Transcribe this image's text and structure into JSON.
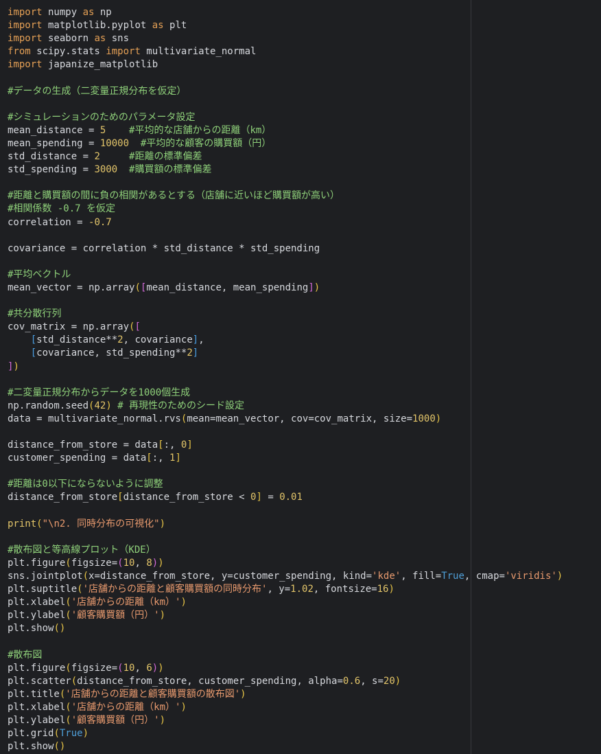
{
  "lines": [
    [
      {
        "t": "import",
        "c": "kw"
      },
      {
        "t": " numpy ",
        "c": "pl"
      },
      {
        "t": "as",
        "c": "kw"
      },
      {
        "t": " np",
        "c": "pl"
      }
    ],
    [
      {
        "t": "import",
        "c": "kw"
      },
      {
        "t": " matplotlib.pyplot ",
        "c": "pl"
      },
      {
        "t": "as",
        "c": "kw"
      },
      {
        "t": " plt",
        "c": "pl"
      }
    ],
    [
      {
        "t": "import",
        "c": "kw"
      },
      {
        "t": " seaborn ",
        "c": "pl"
      },
      {
        "t": "as",
        "c": "kw"
      },
      {
        "t": " sns",
        "c": "pl"
      }
    ],
    [
      {
        "t": "from",
        "c": "kw"
      },
      {
        "t": " scipy.stats ",
        "c": "pl"
      },
      {
        "t": "import",
        "c": "kw"
      },
      {
        "t": " multivariate_normal",
        "c": "pl"
      }
    ],
    [
      {
        "t": "import",
        "c": "kw"
      },
      {
        "t": " japanize_matplotlib",
        "c": "pl"
      }
    ],
    [],
    [
      {
        "t": "#データの生成（二変量正規分布を仮定）",
        "c": "cm"
      }
    ],
    [],
    [
      {
        "t": "#シミュレーションのためのパラメータ設定",
        "c": "cm"
      }
    ],
    [
      {
        "t": "mean_distance = ",
        "c": "pl"
      },
      {
        "t": "5",
        "c": "nm"
      },
      {
        "t": "    ",
        "c": "pl"
      },
      {
        "t": "#平均的な店舗からの距離（km）",
        "c": "cm"
      }
    ],
    [
      {
        "t": "mean_spending = ",
        "c": "pl"
      },
      {
        "t": "10000",
        "c": "nm"
      },
      {
        "t": "  ",
        "c": "pl"
      },
      {
        "t": "#平均的な顧客の購買額（円）",
        "c": "cm"
      }
    ],
    [
      {
        "t": "std_distance = ",
        "c": "pl"
      },
      {
        "t": "2",
        "c": "nm"
      },
      {
        "t": "     ",
        "c": "pl"
      },
      {
        "t": "#距離の標準偏差",
        "c": "cm"
      }
    ],
    [
      {
        "t": "std_spending = ",
        "c": "pl"
      },
      {
        "t": "3000",
        "c": "nm"
      },
      {
        "t": "  ",
        "c": "pl"
      },
      {
        "t": "#購買額の標準偏差",
        "c": "cm"
      }
    ],
    [],
    [
      {
        "t": "#距離と購買額の間に負の相関があるとする（店舗に近いほど購買額が高い）",
        "c": "cm"
      }
    ],
    [
      {
        "t": "#相関係数 -0.7 を仮定",
        "c": "cm"
      }
    ],
    [
      {
        "t": "correlation = ",
        "c": "pl"
      },
      {
        "t": "-0.7",
        "c": "nm"
      }
    ],
    [],
    [
      {
        "t": "covariance = correlation * std_distance * std_spending",
        "c": "pl"
      }
    ],
    [],
    [
      {
        "t": "#平均ベクトル",
        "c": "cm"
      }
    ],
    [
      {
        "t": "mean_vector = np.array",
        "c": "pl"
      },
      {
        "t": "(",
        "c": "br1"
      },
      {
        "t": "[",
        "c": "br2"
      },
      {
        "t": "mean_distance, mean_spending",
        "c": "pl"
      },
      {
        "t": "]",
        "c": "br2"
      },
      {
        "t": ")",
        "c": "br1"
      }
    ],
    [],
    [
      {
        "t": "#共分散行列",
        "c": "cm"
      }
    ],
    [
      {
        "t": "cov_matrix = np.array",
        "c": "pl"
      },
      {
        "t": "(",
        "c": "br1"
      },
      {
        "t": "[",
        "c": "br2"
      }
    ],
    [
      {
        "t": "    ",
        "c": "pl"
      },
      {
        "t": "[",
        "c": "br3"
      },
      {
        "t": "std_distance**",
        "c": "pl"
      },
      {
        "t": "2",
        "c": "nm"
      },
      {
        "t": ", covariance",
        "c": "pl"
      },
      {
        "t": "]",
        "c": "br3"
      },
      {
        "t": ",",
        "c": "pl"
      }
    ],
    [
      {
        "t": "    ",
        "c": "pl"
      },
      {
        "t": "[",
        "c": "br3"
      },
      {
        "t": "covariance, std_spending**",
        "c": "pl"
      },
      {
        "t": "2",
        "c": "nm"
      },
      {
        "t": "]",
        "c": "br3"
      }
    ],
    [
      {
        "t": "]",
        "c": "br2"
      },
      {
        "t": ")",
        "c": "br1"
      }
    ],
    [],
    [
      {
        "t": "#二変量正規分布からデータを1000個生成",
        "c": "cm"
      }
    ],
    [
      {
        "t": "np.random.seed",
        "c": "pl"
      },
      {
        "t": "(",
        "c": "br1"
      },
      {
        "t": "42",
        "c": "nm"
      },
      {
        "t": ")",
        "c": "br1"
      },
      {
        "t": " ",
        "c": "pl"
      },
      {
        "t": "# 再現性のためのシード設定",
        "c": "cm"
      }
    ],
    [
      {
        "t": "data = multivariate_normal.rvs",
        "c": "pl"
      },
      {
        "t": "(",
        "c": "br1"
      },
      {
        "t": "mean=mean_vector, cov=cov_matrix, size=",
        "c": "pl"
      },
      {
        "t": "1000",
        "c": "nm"
      },
      {
        "t": ")",
        "c": "br1"
      }
    ],
    [],
    [
      {
        "t": "distance_from_store = data",
        "c": "pl"
      },
      {
        "t": "[",
        "c": "br1"
      },
      {
        "t": ":, ",
        "c": "pl"
      },
      {
        "t": "0",
        "c": "nm"
      },
      {
        "t": "]",
        "c": "br1"
      }
    ],
    [
      {
        "t": "customer_spending = data",
        "c": "pl"
      },
      {
        "t": "[",
        "c": "br1"
      },
      {
        "t": ":, ",
        "c": "pl"
      },
      {
        "t": "1",
        "c": "nm"
      },
      {
        "t": "]",
        "c": "br1"
      }
    ],
    [],
    [
      {
        "t": "#距離は0以下にならないように調整",
        "c": "cm"
      }
    ],
    [
      {
        "t": "distance_from_store",
        "c": "pl"
      },
      {
        "t": "[",
        "c": "br1"
      },
      {
        "t": "distance_from_store < ",
        "c": "pl"
      },
      {
        "t": "0",
        "c": "nm"
      },
      {
        "t": "]",
        "c": "br1"
      },
      {
        "t": " = ",
        "c": "pl"
      },
      {
        "t": "0.01",
        "c": "nm"
      }
    ],
    [],
    [
      {
        "t": "print",
        "c": "nm"
      },
      {
        "t": "(",
        "c": "br1"
      },
      {
        "t": "\"\\n2. 同時分布の可視化\"",
        "c": "st"
      },
      {
        "t": ")",
        "c": "br1"
      }
    ],
    [],
    [
      {
        "t": "#散布図と等高線プロット（KDE）",
        "c": "cm"
      }
    ],
    [
      {
        "t": "plt.figure",
        "c": "pl"
      },
      {
        "t": "(",
        "c": "br1"
      },
      {
        "t": "figsize=",
        "c": "pl"
      },
      {
        "t": "(",
        "c": "br2"
      },
      {
        "t": "10",
        "c": "nm"
      },
      {
        "t": ", ",
        "c": "pl"
      },
      {
        "t": "8",
        "c": "nm"
      },
      {
        "t": ")",
        "c": "br2"
      },
      {
        "t": ")",
        "c": "br1"
      }
    ],
    [
      {
        "t": "sns.jointplot",
        "c": "pl"
      },
      {
        "t": "(",
        "c": "br1"
      },
      {
        "t": "x=distance_from_store, y=customer_spending, kind=",
        "c": "pl"
      },
      {
        "t": "'kde'",
        "c": "st"
      },
      {
        "t": ", fill=",
        "c": "pl"
      },
      {
        "t": "True",
        "c": "bl"
      },
      {
        "t": ", cmap=",
        "c": "pl"
      },
      {
        "t": "'viridis'",
        "c": "st"
      },
      {
        "t": ")",
        "c": "br1"
      }
    ],
    [
      {
        "t": "plt.suptitle",
        "c": "pl"
      },
      {
        "t": "(",
        "c": "br1"
      },
      {
        "t": "'店舗からの距離と顧客購買額の同時分布'",
        "c": "st"
      },
      {
        "t": ", y=",
        "c": "pl"
      },
      {
        "t": "1.02",
        "c": "nm"
      },
      {
        "t": ", fontsize=",
        "c": "pl"
      },
      {
        "t": "16",
        "c": "nm"
      },
      {
        "t": ")",
        "c": "br1"
      }
    ],
    [
      {
        "t": "plt.xlabel",
        "c": "pl"
      },
      {
        "t": "(",
        "c": "br1"
      },
      {
        "t": "'店舗からの距離（km）'",
        "c": "st"
      },
      {
        "t": ")",
        "c": "br1"
      }
    ],
    [
      {
        "t": "plt.ylabel",
        "c": "pl"
      },
      {
        "t": "(",
        "c": "br1"
      },
      {
        "t": "'顧客購買額（円）'",
        "c": "st"
      },
      {
        "t": ")",
        "c": "br1"
      }
    ],
    [
      {
        "t": "plt.show",
        "c": "pl"
      },
      {
        "t": "()",
        "c": "br1"
      }
    ],
    [],
    [
      {
        "t": "#散布図",
        "c": "cm"
      }
    ],
    [
      {
        "t": "plt.figure",
        "c": "pl"
      },
      {
        "t": "(",
        "c": "br1"
      },
      {
        "t": "figsize=",
        "c": "pl"
      },
      {
        "t": "(",
        "c": "br2"
      },
      {
        "t": "10",
        "c": "nm"
      },
      {
        "t": ", ",
        "c": "pl"
      },
      {
        "t": "6",
        "c": "nm"
      },
      {
        "t": ")",
        "c": "br2"
      },
      {
        "t": ")",
        "c": "br1"
      }
    ],
    [
      {
        "t": "plt.scatter",
        "c": "pl"
      },
      {
        "t": "(",
        "c": "br1"
      },
      {
        "t": "distance_from_store, customer_spending, alpha=",
        "c": "pl"
      },
      {
        "t": "0.6",
        "c": "nm"
      },
      {
        "t": ", s=",
        "c": "pl"
      },
      {
        "t": "20",
        "c": "nm"
      },
      {
        "t": ")",
        "c": "br1"
      }
    ],
    [
      {
        "t": "plt.title",
        "c": "pl"
      },
      {
        "t": "(",
        "c": "br1"
      },
      {
        "t": "'店舗からの距離と顧客購買額の散布図'",
        "c": "st"
      },
      {
        "t": ")",
        "c": "br1"
      }
    ],
    [
      {
        "t": "plt.xlabel",
        "c": "pl"
      },
      {
        "t": "(",
        "c": "br1"
      },
      {
        "t": "'店舗からの距離（km）'",
        "c": "st"
      },
      {
        "t": ")",
        "c": "br1"
      }
    ],
    [
      {
        "t": "plt.ylabel",
        "c": "pl"
      },
      {
        "t": "(",
        "c": "br1"
      },
      {
        "t": "'顧客購買額（円）'",
        "c": "st"
      },
      {
        "t": ")",
        "c": "br1"
      }
    ],
    [
      {
        "t": "plt.grid",
        "c": "pl"
      },
      {
        "t": "(",
        "c": "br1"
      },
      {
        "t": "True",
        "c": "bl"
      },
      {
        "t": ")",
        "c": "br1"
      }
    ],
    [
      {
        "t": "plt.show",
        "c": "pl"
      },
      {
        "t": "()",
        "c": "br1"
      }
    ]
  ]
}
